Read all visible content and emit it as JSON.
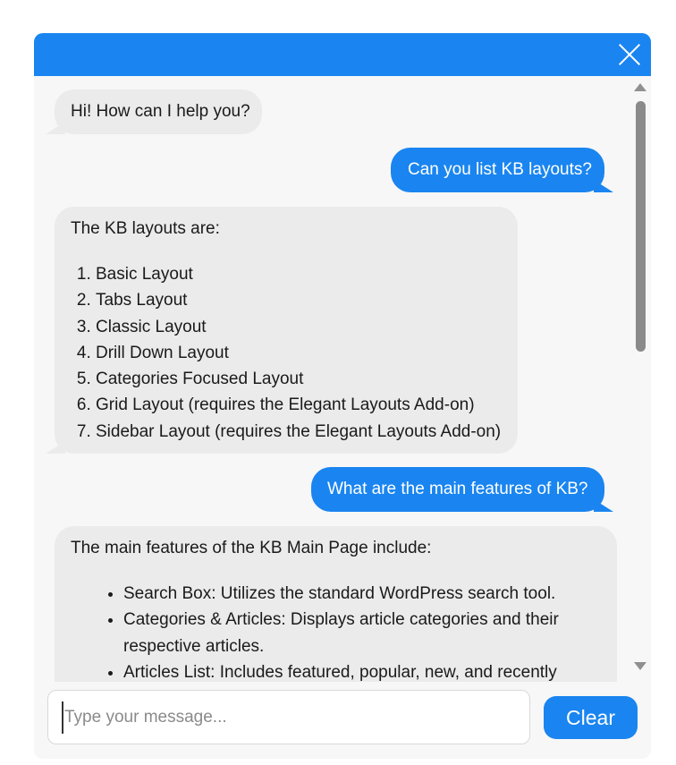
{
  "header": {
    "close_icon": "close-icon",
    "color": "#1a85f0"
  },
  "messages": [
    {
      "role": "bot",
      "text": "Hi! How can I help you?"
    },
    {
      "role": "user",
      "text": "Can you list KB layouts?"
    },
    {
      "role": "bot",
      "intro": "The KB layouts are:",
      "list": [
        "Basic Layout",
        "Tabs Layout",
        "Classic Layout",
        "Drill Down Layout",
        "Categories Focused Layout",
        "Grid Layout (requires the Elegant Layouts Add-on)",
        "Sidebar Layout (requires the Elegant Layouts Add-on)"
      ]
    },
    {
      "role": "user",
      "text": "What are the main features of KB?"
    },
    {
      "role": "bot",
      "intro": "The main features of the KB Main Page include:",
      "bullets": [
        "Search Box: Utilizes the standard WordPress search tool.",
        "Categories & Articles: Displays article categories and their respective articles.",
        "Articles List: Includes featured, popular, new, and recently"
      ]
    }
  ],
  "input": {
    "placeholder": "Type your message..."
  },
  "clear_button": {
    "label": "Clear"
  },
  "colors": {
    "user_bubble": "#1a85f0",
    "bot_bubble": "#ebebeb",
    "background": "#f7f7f7"
  }
}
